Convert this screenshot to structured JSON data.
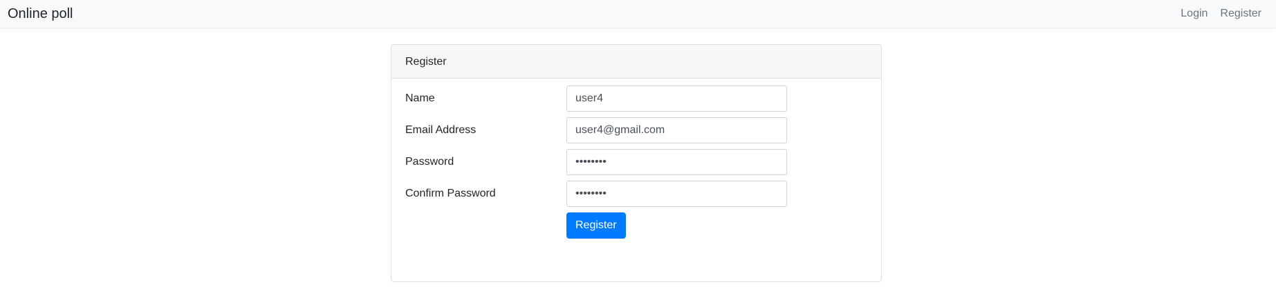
{
  "navbar": {
    "brand": "Online poll",
    "links": [
      "Login",
      "Register"
    ]
  },
  "card": {
    "title": "Register",
    "fields": [
      {
        "label": "Name",
        "value": "user4",
        "type": "text"
      },
      {
        "label": "Email Address",
        "value": "user4@gmail.com",
        "type": "email"
      },
      {
        "label": "Password",
        "value": "abcdefgh",
        "type": "password"
      },
      {
        "label": "Confirm Password",
        "value": "abcdefgh",
        "type": "password"
      }
    ],
    "submit_label": "Register"
  },
  "colors": {
    "primary": "#007bff",
    "navbar_bg": "#f8f9fa",
    "card_header_bg": "#f7f7f7"
  }
}
